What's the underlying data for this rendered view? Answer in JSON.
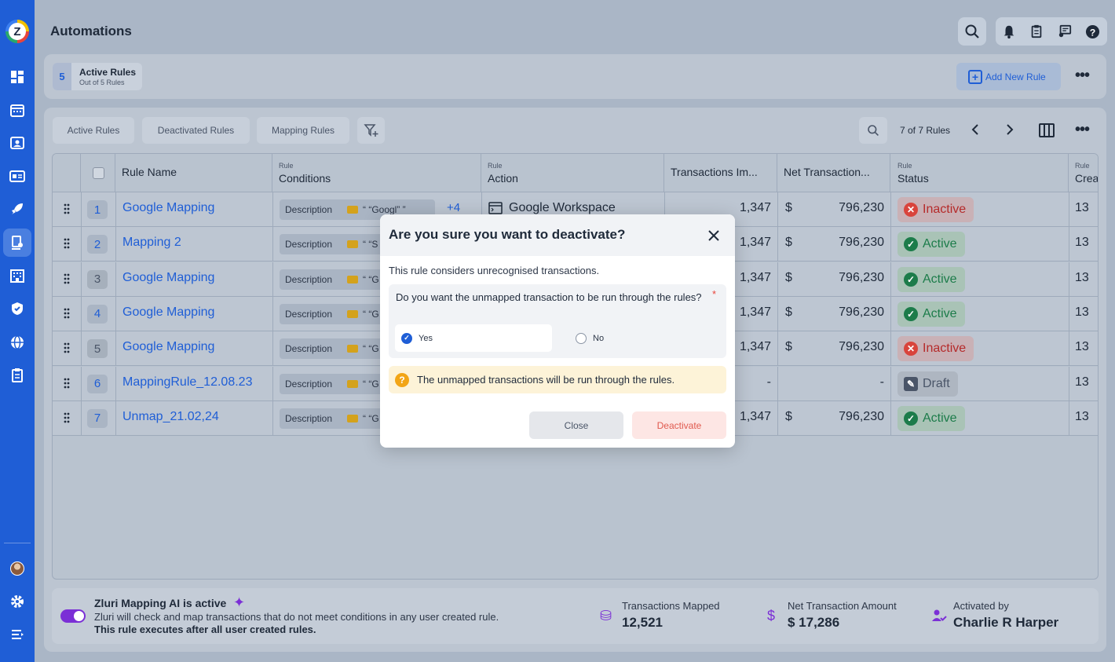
{
  "app": {
    "logo_letter": "Z",
    "page_title": "Automations"
  },
  "sidebar": {
    "items": [
      {
        "icon": "dashboard-icon"
      },
      {
        "icon": "calendar-icon"
      },
      {
        "icon": "user-card-icon"
      },
      {
        "icon": "id-card-icon"
      },
      {
        "icon": "rocket-icon"
      },
      {
        "icon": "automation-icon",
        "active": true
      },
      {
        "icon": "building-icon"
      },
      {
        "icon": "shield-icon"
      },
      {
        "icon": "globe-icon"
      },
      {
        "icon": "clipboard-icon"
      }
    ],
    "bottom_items": [
      {
        "icon": "avatar"
      },
      {
        "icon": "gear-icon"
      },
      {
        "icon": "expand-menu-icon"
      }
    ]
  },
  "header": {
    "icons": [
      "search-icon",
      "bell-icon",
      "clipboard-icon",
      "chat-icon",
      "help-icon"
    ]
  },
  "summary": {
    "active_count": "5",
    "active_title": "Active Rules",
    "active_sub": "Out of 5 Rules",
    "add_rule_label": "Add New Rule"
  },
  "tabs": [
    "Active Rules",
    "Deactivated Rules",
    "Mapping Rules"
  ],
  "pager": {
    "text": "7 of 7 Rules"
  },
  "table": {
    "headers": {
      "rule_name": "Rule Name",
      "conditions_small": "Rule",
      "conditions": "Conditions",
      "action_small": "Rule",
      "action": "Action",
      "txn": "Transactions Im...",
      "net": "Net Transaction...",
      "status_small": "Rule",
      "status": "Status",
      "created_small": "Rule",
      "created": "Crea"
    },
    "rows": [
      {
        "num": "1",
        "name": "Google Mapping",
        "cond_label": "Description",
        "cond_value": "“ “Googl” ”",
        "more": "+4",
        "action": "Google Workspace",
        "txn": "1,347",
        "dollar": "$",
        "net": "796,230",
        "status": "Inactive",
        "created": "13"
      },
      {
        "num": "2",
        "name": "Mapping 2",
        "cond_label": "Description",
        "cond_value": "“ “S",
        "more": "",
        "action": "",
        "txn": "1,347",
        "dollar": "$",
        "net": "796,230",
        "status": "Active",
        "created": "13"
      },
      {
        "num": "3",
        "name": "Google Mapping",
        "cond_label": "Description",
        "cond_value": "“ “G",
        "more": "",
        "action": "",
        "txn": "1,347",
        "dollar": "$",
        "net": "796,230",
        "status": "Active",
        "created": "13"
      },
      {
        "num": "4",
        "name": "Google Mapping",
        "cond_label": "Description",
        "cond_value": "“ “G",
        "more": "",
        "action": "",
        "txn": "1,347",
        "dollar": "$",
        "net": "796,230",
        "status": "Active",
        "created": "13"
      },
      {
        "num": "5",
        "name": "Google Mapping",
        "cond_label": "Description",
        "cond_value": "“ “G",
        "more": "",
        "action": "",
        "txn": "1,347",
        "dollar": "$",
        "net": "796,230",
        "status": "Inactive",
        "created": "13"
      },
      {
        "num": "6",
        "name": "MappingRule_12.08.23",
        "cond_label": "Description",
        "cond_value": "“ “G",
        "more": "",
        "action": "",
        "txn": "-",
        "dollar": "",
        "net": "-",
        "status": "Draft",
        "created": "13"
      },
      {
        "num": "7",
        "name": "Unmap_21.02,24",
        "cond_label": "Description",
        "cond_value": "“ “G",
        "more": "",
        "action": "",
        "txn": "1,347",
        "dollar": "$",
        "net": "796,230",
        "status": "Active",
        "created": "13"
      }
    ]
  },
  "ai_bar": {
    "title": "Zluri Mapping AI is active",
    "desc": "Zluri will check and map transactions that do not meet conditions in any user created rule.",
    "desc_bold": "This rule executes after all user created rules.",
    "txn_label": "Transactions Mapped",
    "txn_value": "12,521",
    "net_label": "Net Transaction Amount",
    "net_value": "$ 17,286",
    "activated_label": "Activated by",
    "activated_value": "Charlie R Harper"
  },
  "modal": {
    "title": "Are you sure you want to deactivate?",
    "text": "This rule considers unrecognised transactions.",
    "question": "Do you want the unmapped transaction to be run through the rules?",
    "required": "*",
    "option_yes": "Yes",
    "option_no": "No",
    "warning": "The unmapped transactions will be run through the rules.",
    "close_label": "Close",
    "deactivate_label": "Deactivate"
  },
  "colors": {
    "brand": "#1f5ed6",
    "ai_purple": "#7b2fd6",
    "active": "#1c7c4a",
    "inactive": "#b52a2a"
  }
}
